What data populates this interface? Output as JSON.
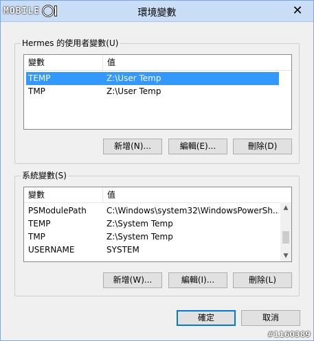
{
  "window": {
    "title": "環境變數",
    "close_glyph": "✕"
  },
  "logo": {
    "text": "MOBILE"
  },
  "user_group": {
    "title": "Hermes 的使用者變數(U)",
    "columns": [
      "變數",
      "值"
    ],
    "rows": [
      {
        "name": "TEMP",
        "value": "Z:\\User Temp",
        "selected": true
      },
      {
        "name": "TMP",
        "value": "Z:\\User Temp",
        "selected": false
      }
    ],
    "buttons": {
      "new": "新增(N)...",
      "edit": "編輯(E)...",
      "delete": "刪除(D)"
    }
  },
  "system_group": {
    "title": "系統變數(S)",
    "columns": [
      "變數",
      "值"
    ],
    "rows": [
      {
        "name": "PSModulePath",
        "value": "C:\\Windows\\system32\\WindowsPowerSh..."
      },
      {
        "name": "TEMP",
        "value": "Z:\\System Temp"
      },
      {
        "name": "TMP",
        "value": "Z:\\System Temp"
      },
      {
        "name": "USERNAME",
        "value": "SYSTEM"
      }
    ],
    "buttons": {
      "new": "新增(W)...",
      "edit": "編輯(I)...",
      "delete": "刪除(L)"
    }
  },
  "dialog_buttons": {
    "ok": "確定",
    "cancel": "取消"
  },
  "watermark": "#1160389",
  "colors": {
    "selection": "#3399ff",
    "titlebar": "#c9ddf6",
    "default_button_border": "#0078d7"
  }
}
